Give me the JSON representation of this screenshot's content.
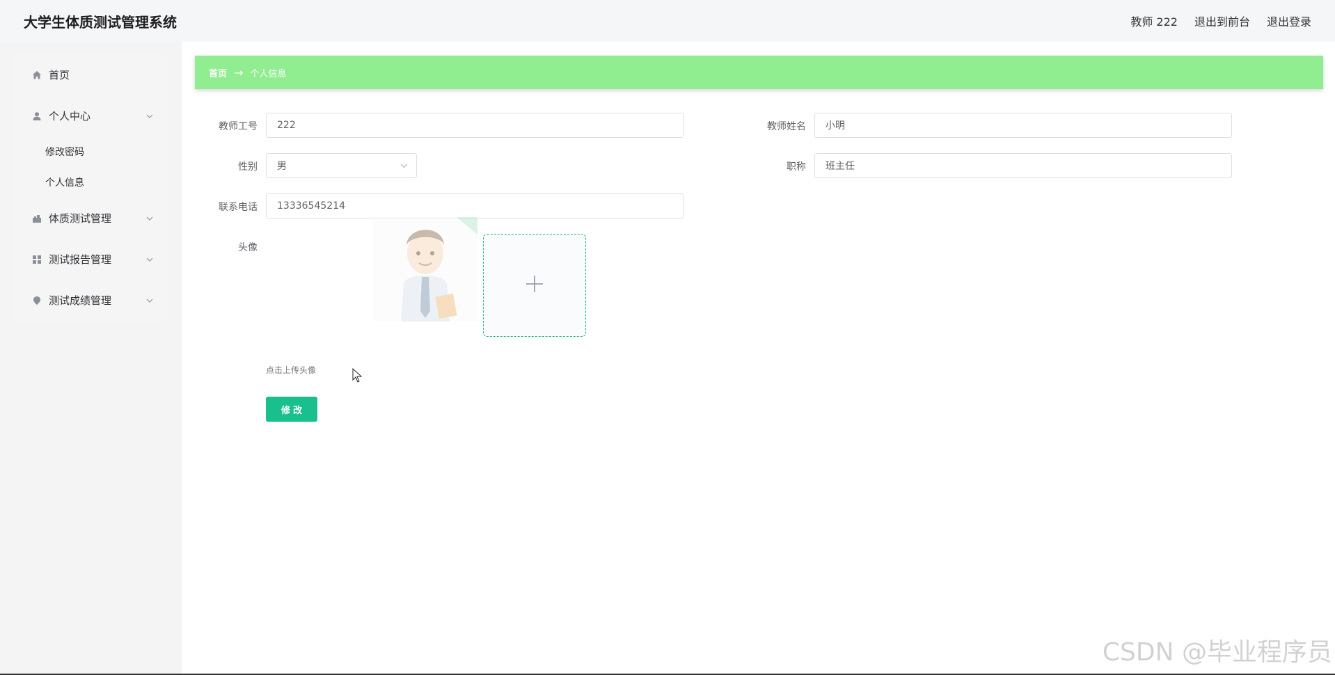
{
  "header": {
    "title": "大学生体质测试管理系统",
    "user": "教师 222",
    "to_front": "退出到前台",
    "logout": "退出登录"
  },
  "sidebar": {
    "home": "首页",
    "personal_center": "个人中心",
    "change_password": "修改密码",
    "personal_info": "个人信息",
    "physical_test_mgmt": "体质测试管理",
    "report_mgmt": "测试报告管理",
    "score_mgmt": "测试成绩管理"
  },
  "breadcrumb": {
    "home": "首页",
    "separator": "→",
    "current": "个人信息"
  },
  "form": {
    "teacher_id_label": "教师工号",
    "teacher_id_value": "222",
    "teacher_name_label": "教师姓名",
    "teacher_name_value": "小明",
    "gender_label": "性别",
    "gender_value": "男",
    "title_label": "职称",
    "title_value": "班主任",
    "phone_label": "联系电话",
    "phone_value": "13336545214",
    "avatar_label": "头像",
    "upload_tip": "点击上传头像",
    "submit": "修改"
  },
  "watermark": "CSDN @毕业程序员",
  "colors": {
    "breadcrumb_bg": "#90ee90",
    "primary_button": "#19c08e",
    "uploader_border": "#19b48a"
  },
  "icons": {
    "home": "home-icon",
    "user": "user-icon",
    "physical": "chart-icon",
    "report": "grid-icon",
    "score": "pin-icon",
    "arrow": "chevron-down-icon",
    "plus": "plus-icon"
  }
}
